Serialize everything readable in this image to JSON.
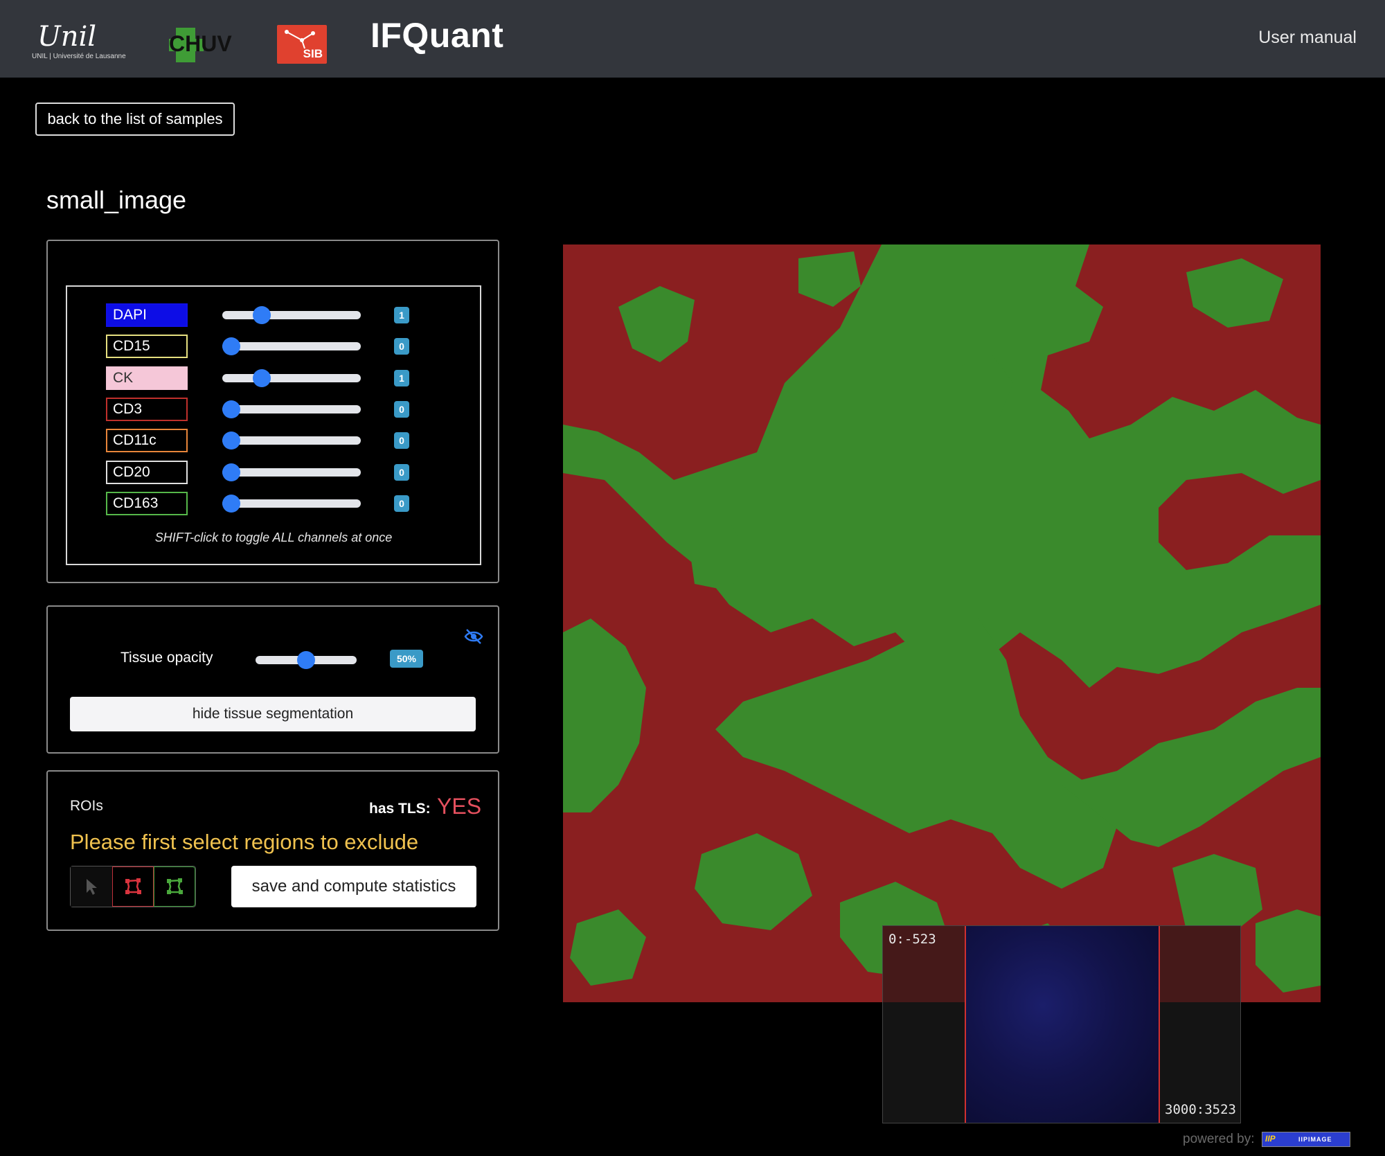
{
  "header": {
    "unil_script": "Unil",
    "unil_sub": "UNIL | Université de Lausanne",
    "sib_text": "SIB",
    "app_title": "IFQuant",
    "manual_link": "User manual"
  },
  "nav": {
    "back_label": "back to the list of samples"
  },
  "sample": {
    "title": "small_image"
  },
  "channels": {
    "items": [
      {
        "name": "DAPI",
        "value": "1",
        "level": 0.25,
        "border": "#1010e8",
        "fill": "#0d0de6",
        "text": "#ffffff"
      },
      {
        "name": "CD15",
        "value": "0",
        "level": 0.0,
        "border": "#e6e080",
        "fill": "#000000",
        "text": "#ffffff"
      },
      {
        "name": "CK",
        "value": "1",
        "level": 0.25,
        "border": "#f5c7d8",
        "fill": "#f5c7d8",
        "text": "#333333"
      },
      {
        "name": "CD3",
        "value": "0",
        "level": 0.0,
        "border": "#c0302c",
        "fill": "#000000",
        "text": "#ffffff"
      },
      {
        "name": "CD11c",
        "value": "0",
        "level": 0.0,
        "border": "#e8853a",
        "fill": "#000000",
        "text": "#ffffff"
      },
      {
        "name": "CD20",
        "value": "0",
        "level": 0.0,
        "border": "#e0e0e0",
        "fill": "#000000",
        "text": "#ffffff"
      },
      {
        "name": "CD163",
        "value": "0",
        "level": 0.0,
        "border": "#56b84a",
        "fill": "#000000",
        "text": "#ffffff"
      }
    ],
    "hint": "SHIFT-click to toggle ALL channels at once"
  },
  "tissue": {
    "label": "Tissue opacity",
    "value": "50%",
    "level": 0.5,
    "hide_button": "hide tissue segmentation",
    "icon": "eye-slash-icon"
  },
  "roi": {
    "label": "ROIs",
    "tls_label": "has TLS:",
    "tls_value": "YES",
    "warning": "Please first select regions to exclude",
    "tools": [
      "cursor-icon",
      "exclude-polygon-icon",
      "include-polygon-icon"
    ],
    "save_button": "save and compute statistics"
  },
  "viewer": {
    "coord_start": "0:-523",
    "coord_end": "3000:3523",
    "powered_by": "powered by:",
    "iip_left": "IIP",
    "iip_right": "IIPIMAGE"
  },
  "colors": {
    "header_bg": "#33363c",
    "tumor_red": "#8a1f20",
    "stroma_green": "#3a8a2c",
    "accent_blue": "#2f7cf6",
    "badge_blue": "#3a9ac7",
    "warning_yellow": "#f0c24f",
    "tls_red": "#e5505e"
  }
}
